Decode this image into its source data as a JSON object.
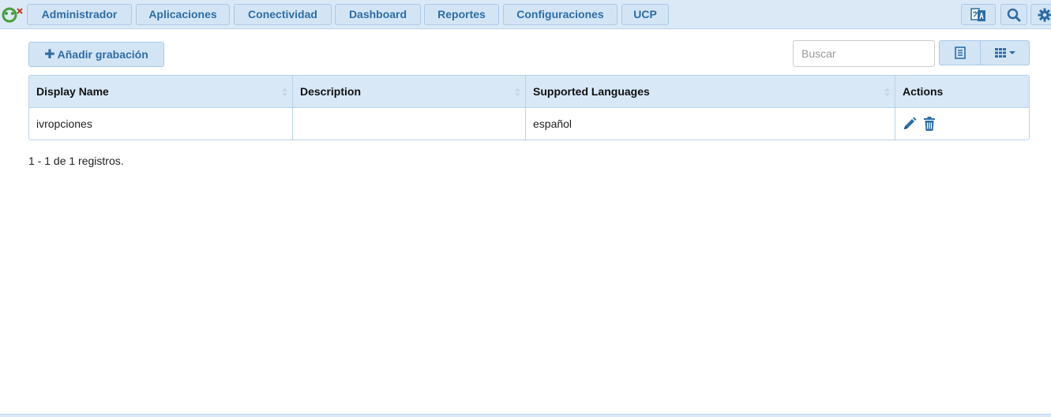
{
  "nav": {
    "items": [
      "Administrador",
      "Aplicaciones",
      "Conectividad",
      "Dashboard",
      "Reportes",
      "Configuraciones",
      "UCP"
    ],
    "icons": [
      "translate-icon",
      "search-icon",
      "gear-icon"
    ]
  },
  "toolbar": {
    "add_label": "Añadir grabación",
    "search_placeholder": "Buscar"
  },
  "table": {
    "headers": [
      "Display Name",
      "Description",
      "Supported Languages",
      "Actions"
    ],
    "rows": [
      {
        "display_name": "ivropciones",
        "description": "",
        "languages": "español"
      }
    ]
  },
  "pagination": {
    "summary": "1 - 1 de 1 registros."
  },
  "colors": {
    "accent": "#2e6da4",
    "header_bg": "#dbe9f6",
    "border": "#b9d3ea"
  }
}
